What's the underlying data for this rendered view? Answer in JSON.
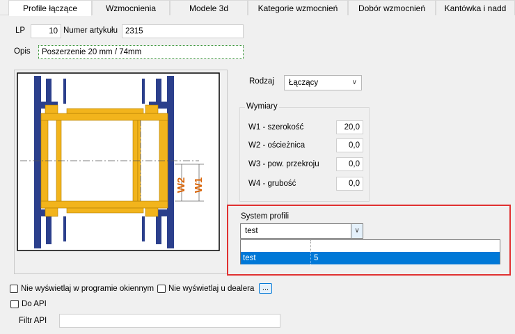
{
  "tabs": [
    {
      "label": "Profile łączące",
      "active": true
    },
    {
      "label": "Wzmocnienia"
    },
    {
      "label": "Modele 3d"
    },
    {
      "label": "Kategorie wzmocnień"
    },
    {
      "label": "Dobór wzmocnień"
    },
    {
      "label": "Kantówka i nadd"
    }
  ],
  "form": {
    "lp_label": "LP",
    "lp_value": "10",
    "article_label": "Numer artykułu",
    "article_value": "2315",
    "opis_label": "Opis",
    "opis_value": "Poszerzenie 20 mm / 74mm"
  },
  "rodzaj": {
    "label": "Rodzaj",
    "value": "Łączący"
  },
  "wymiary": {
    "title": "Wymiary",
    "rows": [
      {
        "label": "W1 - szerokość",
        "value": "20,0"
      },
      {
        "label": "W2 - ościeżnica",
        "value": "0,0"
      },
      {
        "label": "W3 - pow. przekroju",
        "value": "0,0"
      },
      {
        "label": "W4 - grubość",
        "value": "0,0"
      }
    ]
  },
  "system": {
    "label": "System profili",
    "value": "test",
    "options": [
      {
        "name": "",
        "value": ""
      },
      {
        "name": "test",
        "value": "5",
        "selected": true
      }
    ]
  },
  "drawing": {
    "w1_label": "W1",
    "w2_label": "W2"
  },
  "checks": {
    "hide_window_label": "Nie wyświetlaj w programie okiennym",
    "hide_dealer_label": "Nie wyświetlaj u dealera",
    "dots_label": "...",
    "api_label": "Do API",
    "filter_label": "Filtr API",
    "filter_value": ""
  },
  "colors": {
    "profile_yellow": "#f2b41c",
    "frame_blue": "#2b3f8c",
    "dimension_orange": "#d9660b",
    "highlight_red": "#e03131",
    "selection_blue": "#0078d7"
  }
}
